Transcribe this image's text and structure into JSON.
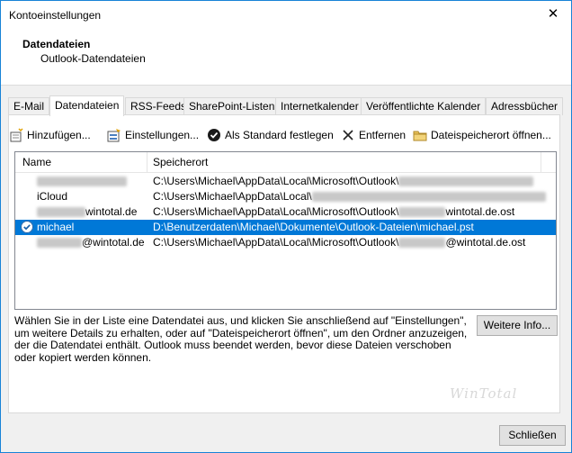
{
  "window": {
    "title": "Kontoeinstellungen",
    "close_glyph": "✕"
  },
  "header": {
    "title": "Datendateien",
    "subtitle": "Outlook-Datendateien"
  },
  "tabs": [
    {
      "label": "E-Mail"
    },
    {
      "label": "Datendateien"
    },
    {
      "label": "RSS-Feeds"
    },
    {
      "label": "SharePoint-Listen"
    },
    {
      "label": "Internetkalender"
    },
    {
      "label": "Veröffentlichte Kalender"
    },
    {
      "label": "Adressbücher"
    }
  ],
  "active_tab": "Datendateien",
  "toolbar": {
    "add": "Hinzufügen...",
    "settings": "Einstellungen...",
    "default": "Als Standard festlegen",
    "remove": "Entfernen",
    "open_location": "Dateispeicherort öffnen..."
  },
  "list": {
    "columns": {
      "name": "Name",
      "location": "Speicherort"
    },
    "rows": [
      {
        "name": "",
        "path": "C:\\Users\\Michael\\AppData\\Local\\Microsoft\\Outlook\\",
        "path_suffix": "",
        "selected": false,
        "default": false
      },
      {
        "name": "iCloud",
        "path": "C:\\Users\\Michael\\AppData\\Local\\",
        "path_suffix": "",
        "selected": false,
        "default": false
      },
      {
        "name": "wintotal.de",
        "path": "C:\\Users\\Michael\\AppData\\Local\\Microsoft\\Outlook\\",
        "path_suffix": "wintotal.de.ost",
        "selected": false,
        "default": false
      },
      {
        "name": "michael",
        "path": "D:\\Benutzerdaten\\Michael\\Dokumente\\Outlook-Dateien\\michael.pst",
        "path_suffix": "",
        "selected": true,
        "default": true
      },
      {
        "name": "@wintotal.de",
        "path": "C:\\Users\\Michael\\AppData\\Local\\Microsoft\\Outlook\\",
        "path_suffix": "@wintotal.de.ost",
        "selected": false,
        "default": false
      }
    ]
  },
  "description": "Wählen Sie in der Liste eine Datendatei aus, und klicken Sie anschließend auf \"Einstellungen\", um weitere Details zu erhalten, oder auf \"Dateispeicherort öffnen\", um den Ordner anzuzeigen, der die Datendatei enthält. Outlook muss beendet werden, bevor diese Dateien verschoben oder kopiert werden können.",
  "buttons": {
    "more_info": "Weitere Info...",
    "close": "Schließen"
  },
  "watermark": "WinTotal",
  "colors": {
    "selection": "#0078d7",
    "accent_border": "#1883d7"
  }
}
